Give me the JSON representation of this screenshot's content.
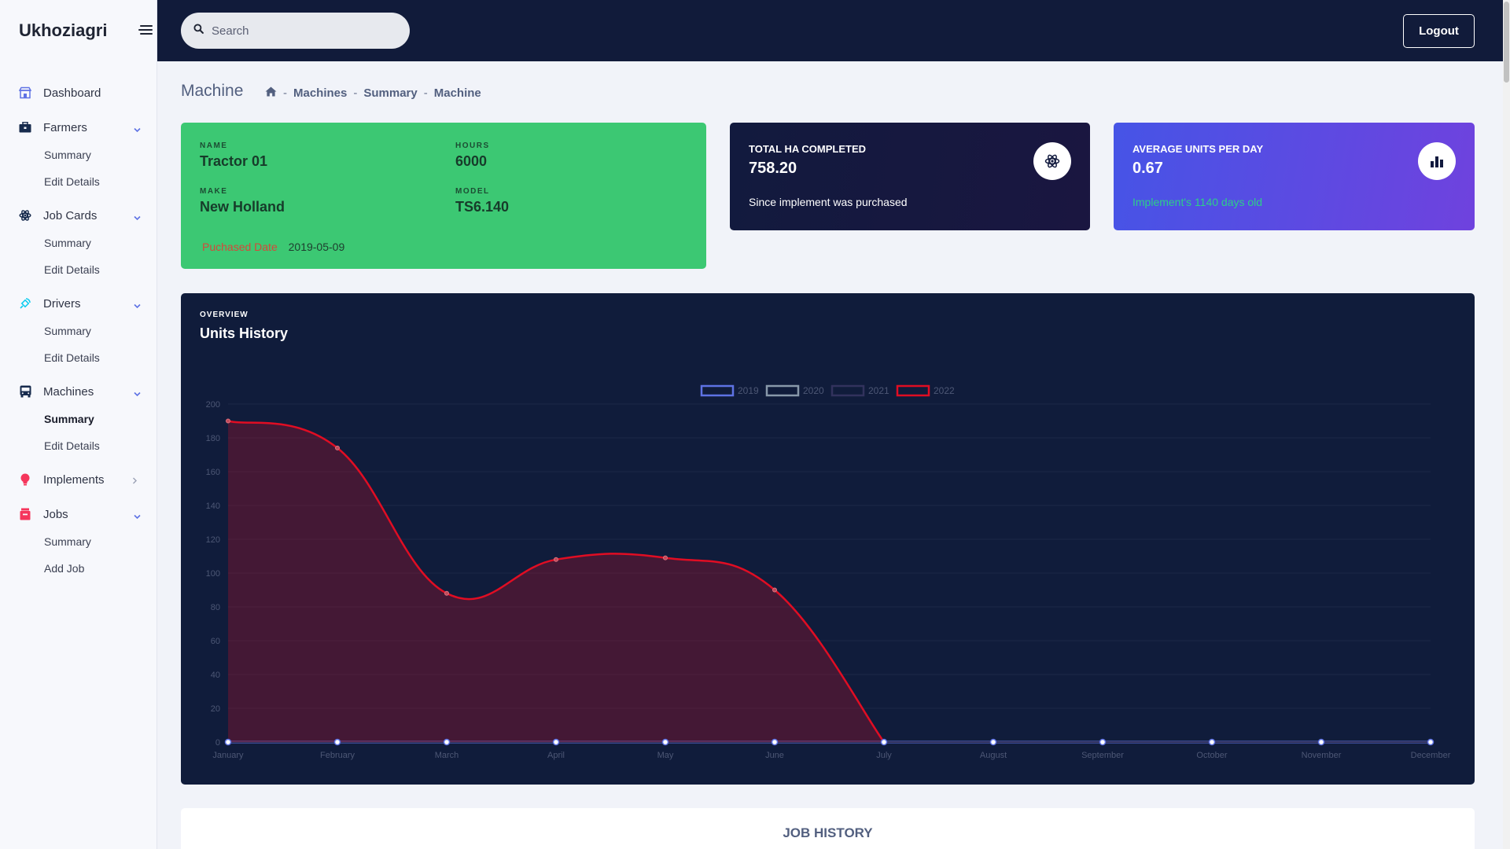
{
  "app": {
    "brand": "Ukhoziagri"
  },
  "header": {
    "search_placeholder": "Search",
    "logout_label": "Logout"
  },
  "sidebar": {
    "items": [
      {
        "label": "Dashboard",
        "icon": "store-icon",
        "sub": []
      },
      {
        "label": "Farmers",
        "icon": "briefcase-icon",
        "sub": [
          "Summary",
          "Edit Details"
        ]
      },
      {
        "label": "Job Cards",
        "icon": "atom-icon",
        "sub": [
          "Summary",
          "Edit Details"
        ]
      },
      {
        "label": "Drivers",
        "icon": "satellite-icon",
        "sub": [
          "Summary",
          "Edit Details"
        ]
      },
      {
        "label": "Machines",
        "icon": "bus-icon",
        "sub": [
          "Summary",
          "Edit Details"
        ]
      },
      {
        "label": "Implements",
        "icon": "bulb-icon",
        "sub": []
      },
      {
        "label": "Jobs",
        "icon": "archive-icon",
        "sub": [
          "Summary",
          "Add Job"
        ]
      }
    ],
    "active_sub": "Machines/Summary",
    "colors": {
      "store": "#5e72e4",
      "briefcase": "#172b4d",
      "atom": "#172b4d",
      "satellite": "#11cdef",
      "bus": "#172b4d",
      "bulb": "#f5365c",
      "archive": "#f5365c",
      "chevron": "#5e72e4"
    }
  },
  "page": {
    "title": "Machine",
    "breadcrumb": [
      "Machines",
      "Summary",
      "Machine"
    ]
  },
  "machine": {
    "name_label": "Name",
    "name": "Tractor 01",
    "hours_label": "Hours",
    "hours": "6000",
    "make_label": "Make",
    "make": "New Holland",
    "model_label": "Model",
    "model": "TS6.140",
    "purchased_label": "Puchased Date",
    "purchased": "2019-05-09"
  },
  "stats": {
    "total_ha": {
      "title": "Total Ha Completed",
      "value": "758.20",
      "sub": "Since implement was purchased",
      "icon": "atom-icon"
    },
    "avg_units": {
      "title": "Average Units per day",
      "value": "0.67",
      "sub": "Implement's 1140 days old",
      "icon": "bar-chart-icon"
    }
  },
  "chart_card": {
    "overline": "Overview",
    "title": "Units History"
  },
  "chart_data": {
    "type": "line",
    "categories": [
      "January",
      "February",
      "March",
      "April",
      "May",
      "June",
      "July",
      "August",
      "September",
      "October",
      "November",
      "December"
    ],
    "ylim": [
      0,
      200
    ],
    "yticks": [
      0,
      20,
      40,
      60,
      80,
      100,
      120,
      140,
      160,
      180,
      200
    ],
    "legend_position": "top-center",
    "series": [
      {
        "name": "2019",
        "color": "#5e72e4",
        "values": [
          0,
          0,
          0,
          0,
          0,
          0,
          0,
          0,
          0,
          0,
          0,
          0
        ]
      },
      {
        "name": "2020",
        "color": "#8898aa",
        "values": [
          0,
          0,
          0,
          0,
          0,
          0,
          0,
          0,
          0,
          0,
          0,
          0
        ]
      },
      {
        "name": "2021",
        "color": "#32325d",
        "values": [
          0,
          0,
          0,
          0,
          0,
          0,
          0,
          0,
          0,
          0,
          0,
          0
        ]
      },
      {
        "name": "2022",
        "color": "#e00d23",
        "values": [
          190,
          174,
          88,
          108,
          109,
          90,
          0
        ]
      }
    ]
  },
  "job_history": {
    "title": "Job History"
  }
}
